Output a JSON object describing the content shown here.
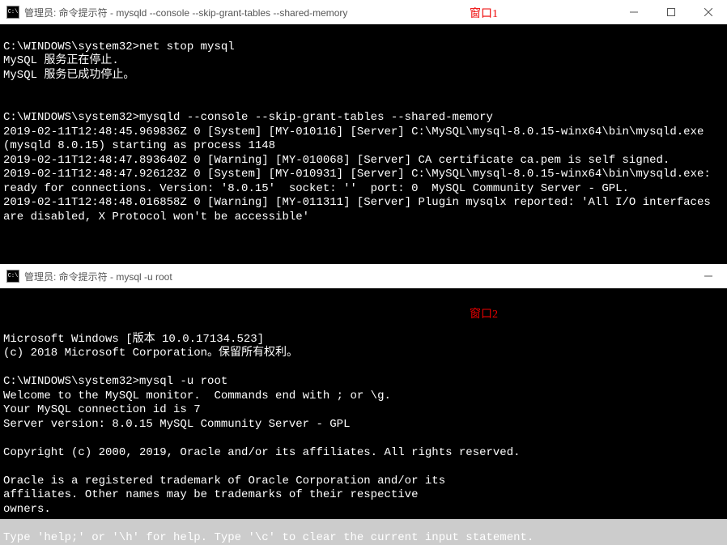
{
  "annotations": {
    "window1": "窗口1",
    "window2": "窗口2"
  },
  "window1": {
    "title": "管理员: 命令提示符 - mysqld  --console --skip-grant-tables --shared-memory",
    "icon_label": "C:\\",
    "controls": {
      "min": "minimize",
      "max": "maximize",
      "close": "close"
    },
    "lines": [
      "",
      "C:\\WINDOWS\\system32>net stop mysql",
      "MySQL 服务正在停止.",
      "MySQL 服务已成功停止。",
      "",
      "",
      "C:\\WINDOWS\\system32>mysqld --console --skip-grant-tables --shared-memory",
      "2019-02-11T12:48:45.969836Z 0 [System] [MY-010116] [Server] C:\\MySQL\\mysql-8.0.15-winx64\\bin\\mysqld.exe (mysqld 8.0.15) starting as process 1148",
      "2019-02-11T12:48:47.893640Z 0 [Warning] [MY-010068] [Server] CA certificate ca.pem is self signed.",
      "2019-02-11T12:48:47.926123Z 0 [System] [MY-010931] [Server] C:\\MySQL\\mysql-8.0.15-winx64\\bin\\mysqld.exe: ready for connections. Version: '8.0.15'  socket: ''  port: 0  MySQL Community Server - GPL.",
      "2019-02-11T12:48:48.016858Z 0 [Warning] [MY-011311] [Server] Plugin mysqlx reported: 'All I/O interfaces are disabled, X Protocol won't be accessible'"
    ]
  },
  "window2": {
    "title": "管理员: 命令提示符 - mysql  -u root",
    "icon_label": "C:\\",
    "controls": {
      "min": "minimize"
    },
    "lines": [
      "Microsoft Windows [版本 10.0.17134.523]",
      "(c) 2018 Microsoft Corporation。保留所有权利。",
      "",
      "C:\\WINDOWS\\system32>mysql -u root",
      "Welcome to the MySQL monitor.  Commands end with ; or \\g.",
      "Your MySQL connection id is 7",
      "Server version: 8.0.15 MySQL Community Server - GPL",
      "",
      "Copyright (c) 2000, 2019, Oracle and/or its affiliates. All rights reserved.",
      "",
      "Oracle is a registered trademark of Oracle Corporation and/or its",
      "affiliates. Other names may be trademarks of their respective",
      "owners.",
      "",
      "Type 'help;' or '\\h' for help. Type '\\c' to clear the current input statement."
    ]
  }
}
